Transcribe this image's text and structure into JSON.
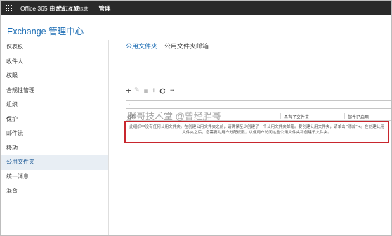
{
  "topbar": {
    "brand_prefix": "Office 365 由",
    "brand_name": "世纪互联",
    "brand_suffix": "运营",
    "admin_label": "管理"
  },
  "app_title": "Exchange 管理中心",
  "sidebar": {
    "items": [
      {
        "label": "仪表板"
      },
      {
        "label": "收件人"
      },
      {
        "label": "权限"
      },
      {
        "label": "合规性管理"
      },
      {
        "label": "组织"
      },
      {
        "label": "保护"
      },
      {
        "label": "邮件流"
      },
      {
        "label": "移动"
      },
      {
        "label": "公用文件夹",
        "active": true
      },
      {
        "label": "统一消息"
      },
      {
        "label": "混合"
      }
    ]
  },
  "tabs": [
    {
      "label": "公用文件夹",
      "active": true
    },
    {
      "label": "公用文件夹邮箱",
      "active": false
    }
  ],
  "toolbar": {
    "add": "+",
    "edit": "✎",
    "delete": "🗑",
    "up": "↑",
    "more": "•••"
  },
  "search": {
    "placeholder": "\\"
  },
  "table": {
    "columns": [
      "名称",
      "具有子文件夹",
      "邮件已启用"
    ]
  },
  "empty_message": "此组织中没有任何公用文件夹。在创建公用文件夹之前，请确保至少创建了一个公用文件夹邮箱。要创建公用文件夹，请单击 \"添加\" +。在创建公用文件夹之后，您需要为用户分配权限，以便用户访问这些公用文件夹和创建子文件夹。",
  "watermark": "胖哥技术堂 @曾经胖哥",
  "colors": {
    "topbar_bg": "#2a2a2a",
    "accent": "#1f6fb5",
    "highlight_border": "#c8272e"
  }
}
